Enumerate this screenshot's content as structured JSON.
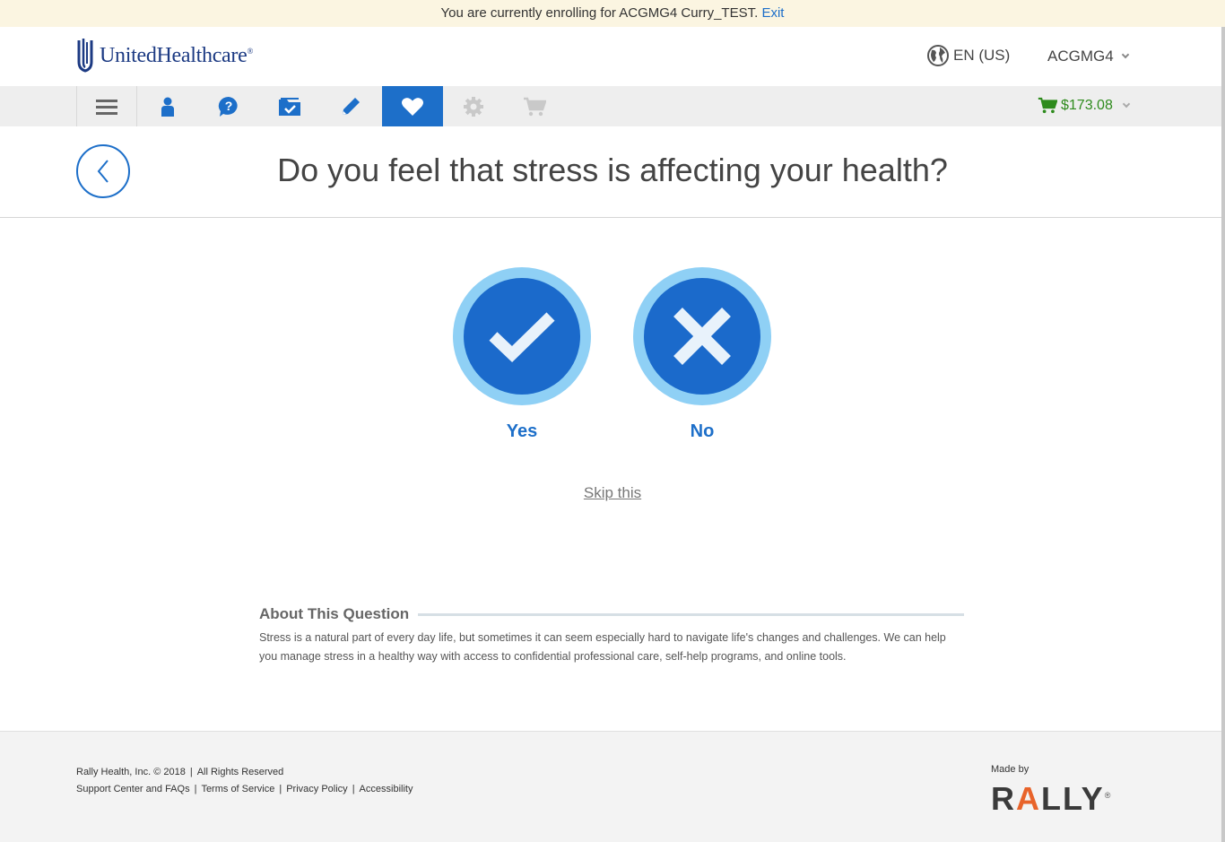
{
  "banner": {
    "text": "You are currently enrolling for ACGMG4 Curry_TEST.",
    "exit_link": "Exit"
  },
  "header": {
    "brand": "UnitedHealthcare",
    "brand_mark": "®",
    "language": "EN (US)",
    "account": "ACGMG4"
  },
  "nav": {
    "items": [
      {
        "name": "menu",
        "icon": "hamburger-icon"
      },
      {
        "name": "profile",
        "icon": "person-icon"
      },
      {
        "name": "help",
        "icon": "question-icon"
      },
      {
        "name": "documents",
        "icon": "folder-check-icon"
      },
      {
        "name": "edit",
        "icon": "pencil-icon"
      },
      {
        "name": "health",
        "icon": "heart-icon",
        "active": true
      },
      {
        "name": "settings",
        "icon": "gear-icon",
        "disabled": true
      },
      {
        "name": "cart",
        "icon": "cart-icon",
        "disabled": true
      }
    ],
    "cart_total": "$173.08"
  },
  "question": {
    "text": "Do you feel that stress is affecting your health?"
  },
  "answers": {
    "yes_label": "Yes",
    "no_label": "No"
  },
  "skip_label": "Skip this",
  "about": {
    "title": "About This Question",
    "body": "Stress is a natural part of every day life, but sometimes it can seem especially hard to navigate life's changes and challenges. We can help you manage stress in a healthy way with access to confidential professional care, self-help programs, and online tools."
  },
  "footer": {
    "copyright": "Rally Health, Inc. © 2018",
    "rights": "All Rights Reserved",
    "links": [
      "Support Center and FAQs",
      "Terms of Service",
      "Privacy Policy",
      "Accessibility"
    ],
    "made_by": "Made by",
    "brand_left": "R",
    "brand_accent": "A",
    "brand_right": "LLY",
    "brand_mark": "®"
  },
  "colors": {
    "primary": "#1d6fc9",
    "ring": "#8fd0f5",
    "cart_green": "#2e8b1d",
    "banner_bg": "#fbf5e1",
    "rally_orange": "#e8632a"
  }
}
